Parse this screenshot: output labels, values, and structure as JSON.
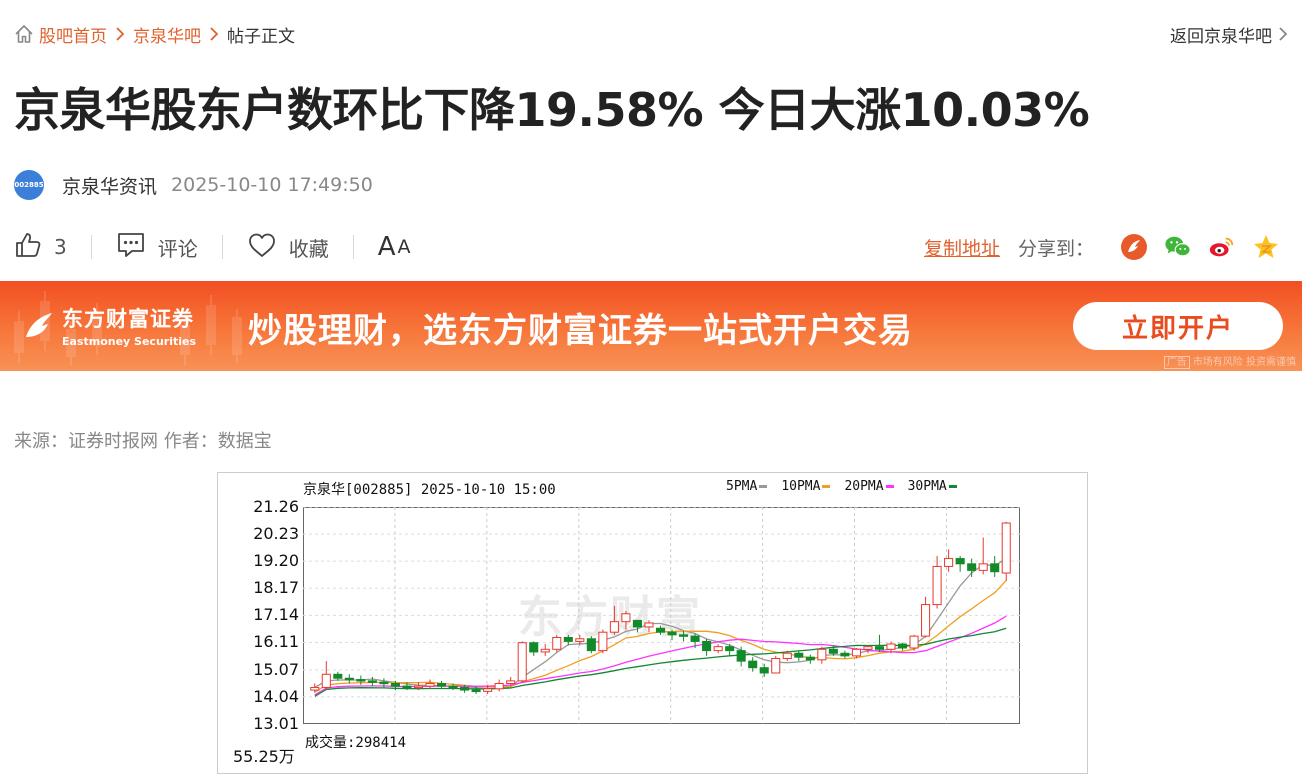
{
  "breadcrumb": {
    "home": "股吧首页",
    "forum": "京泉华吧",
    "current": "帖子正文"
  },
  "back_link": "返回京泉华吧",
  "article": {
    "title": "京泉华股东户数环比下降19.58% 今日大涨10.03%",
    "author": "京泉华资讯",
    "avatar_text": "002885",
    "time": "2025-10-10 17:49:50",
    "source_line": "来源：证券时报网 作者：数据宝"
  },
  "actions": {
    "like_count": "3",
    "comment": "评论",
    "favorite": "收藏",
    "font_big": "A",
    "font_small": "A"
  },
  "share": {
    "copy_link": "复制地址",
    "label": "分享到："
  },
  "banner": {
    "brand_cn": "东方财富证券",
    "brand_en": "Eastmoney Securities",
    "slogan": "炒股理财，选东方财富证券一站式开户交易",
    "button": "立即开户",
    "ad_tag": "广告",
    "disclaimer": "市场有风险 投资需谨慎"
  },
  "colors": {
    "accent": "#e0622d",
    "banner_start": "#f24f22",
    "banner_end": "#f89256",
    "up": "#e8382c",
    "down": "#138a2a"
  },
  "chart_data": {
    "type": "candlestick",
    "header": "京泉华[002885] 2025-10-10 15:00",
    "watermark": "东方财富",
    "legend": [
      {
        "name": "5PMA",
        "color": "#999999"
      },
      {
        "name": "10PMA",
        "color": "#f0a020"
      },
      {
        "name": "20PMA",
        "color": "#ff33ff"
      },
      {
        "name": "30PMA",
        "color": "#118833"
      }
    ],
    "y_ticks": [
      "21.26",
      "20.23",
      "19.20",
      "18.17",
      "17.14",
      "16.11",
      "15.07",
      "14.04",
      "13.01"
    ],
    "ylim": [
      13.01,
      21.26
    ],
    "volume_label": "成交量:298414",
    "volume_ytick": "55.25万",
    "candles": [
      [
        14.3,
        14.4,
        14.55,
        14.2
      ],
      [
        14.4,
        14.9,
        15.4,
        14.3
      ],
      [
        14.9,
        14.75,
        15.0,
        14.65
      ],
      [
        14.75,
        14.7,
        14.9,
        14.55
      ],
      [
        14.7,
        14.65,
        14.85,
        14.5
      ],
      [
        14.65,
        14.6,
        14.8,
        14.45
      ],
      [
        14.6,
        14.55,
        14.75,
        14.4
      ],
      [
        14.55,
        14.45,
        14.65,
        14.3
      ],
      [
        14.45,
        14.4,
        14.6,
        14.3
      ],
      [
        14.4,
        14.45,
        14.6,
        14.3
      ],
      [
        14.45,
        14.55,
        14.7,
        14.35
      ],
      [
        14.55,
        14.45,
        14.65,
        14.35
      ],
      [
        14.45,
        14.4,
        14.55,
        14.3
      ],
      [
        14.4,
        14.3,
        14.5,
        14.2
      ],
      [
        14.3,
        14.25,
        14.45,
        14.15
      ],
      [
        14.25,
        14.35,
        14.5,
        14.15
      ],
      [
        14.35,
        14.55,
        14.7,
        14.25
      ],
      [
        14.55,
        14.65,
        14.8,
        14.45
      ],
      [
        14.65,
        16.1,
        16.15,
        14.6
      ],
      [
        16.1,
        15.75,
        16.15,
        15.6
      ],
      [
        15.75,
        15.85,
        16.05,
        15.6
      ],
      [
        15.85,
        16.3,
        16.4,
        15.75
      ],
      [
        16.3,
        16.15,
        16.4,
        16.0
      ],
      [
        16.15,
        16.25,
        16.4,
        16.0
      ],
      [
        16.25,
        15.8,
        16.35,
        15.7
      ],
      [
        15.8,
        16.5,
        16.6,
        15.7
      ],
      [
        16.5,
        16.9,
        17.5,
        16.4
      ],
      [
        16.9,
        17.2,
        17.3,
        16.6
      ],
      [
        16.95,
        16.7,
        16.95,
        16.5
      ],
      [
        16.7,
        16.85,
        16.95,
        16.5
      ],
      [
        16.65,
        16.5,
        16.75,
        16.4
      ],
      [
        16.5,
        16.4,
        16.6,
        16.2
      ],
      [
        16.4,
        16.35,
        16.55,
        16.15
      ],
      [
        16.35,
        16.15,
        16.45,
        15.9
      ],
      [
        16.15,
        15.8,
        16.25,
        15.6
      ],
      [
        15.8,
        15.95,
        16.05,
        15.7
      ],
      [
        15.95,
        15.8,
        16.05,
        15.6
      ],
      [
        15.8,
        15.4,
        15.95,
        15.2
      ],
      [
        15.4,
        15.15,
        15.55,
        15.0
      ],
      [
        15.15,
        14.95,
        15.3,
        14.8
      ],
      [
        14.95,
        15.5,
        15.6,
        14.95
      ],
      [
        15.5,
        15.7,
        15.8,
        15.4
      ],
      [
        15.7,
        15.55,
        15.8,
        15.4
      ],
      [
        15.55,
        15.45,
        15.65,
        15.3
      ],
      [
        15.45,
        15.85,
        15.95,
        15.3
      ],
      [
        15.85,
        15.7,
        16.0,
        15.6
      ],
      [
        15.7,
        15.6,
        15.8,
        15.5
      ],
      [
        15.6,
        15.85,
        15.9,
        15.5
      ],
      [
        15.85,
        15.95,
        16.0,
        15.7
      ],
      [
        15.95,
        15.85,
        16.4,
        15.75
      ],
      [
        15.85,
        16.05,
        16.15,
        15.7
      ],
      [
        16.05,
        15.9,
        16.1,
        15.8
      ],
      [
        15.9,
        16.35,
        16.4,
        15.8
      ],
      [
        16.35,
        17.55,
        17.85,
        16.3
      ],
      [
        17.55,
        19.0,
        19.4,
        17.4
      ],
      [
        19.0,
        19.3,
        19.65,
        18.8
      ],
      [
        19.3,
        19.1,
        19.4,
        18.8
      ],
      [
        19.1,
        18.85,
        19.3,
        18.6
      ],
      [
        18.85,
        19.1,
        20.1,
        18.7
      ],
      [
        19.1,
        18.8,
        19.4,
        18.6
      ],
      [
        18.75,
        20.65,
        20.7,
        18.45
      ]
    ]
  }
}
